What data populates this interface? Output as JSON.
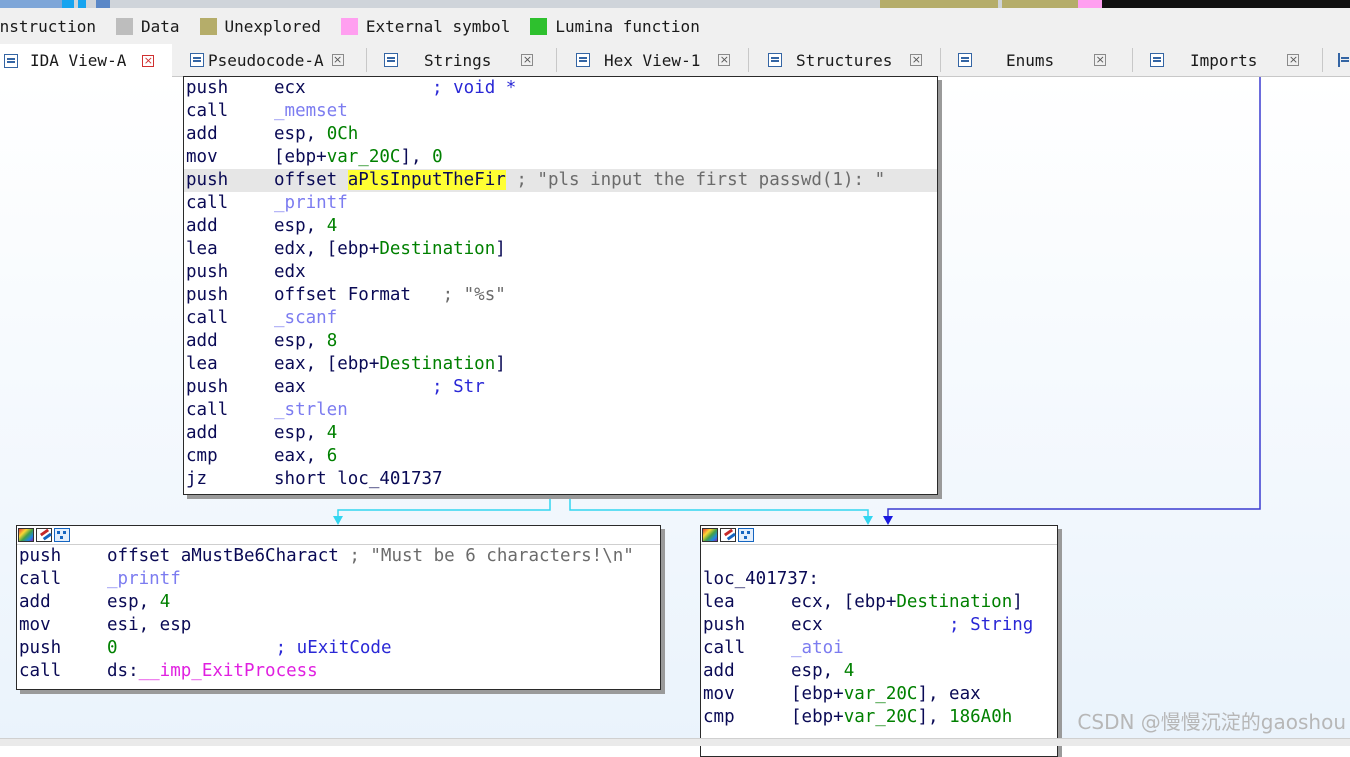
{
  "legend": [
    {
      "label": "Instruction",
      "color": "#bdbdbd"
    },
    {
      "label": "Data",
      "color": "#bdbdbd"
    },
    {
      "label": "Unexplored",
      "color": "#b5ad6a"
    },
    {
      "label": "External symbol",
      "color": "#ff9ff0"
    },
    {
      "label": "Lumina function",
      "color": "#2ec02e"
    }
  ],
  "tabs": [
    {
      "label": "IDA View-A",
      "icon": "graph-view-icon",
      "active": true
    },
    {
      "label": "Pseudocode-A",
      "icon": "pseudocode-icon"
    },
    {
      "label": "Strings",
      "icon": "strings-icon"
    },
    {
      "label": "Hex View-1",
      "icon": "hex-view-icon"
    },
    {
      "label": "Structures",
      "icon": "structures-icon"
    },
    {
      "label": "Enums",
      "icon": "enums-icon"
    },
    {
      "label": "Imports",
      "icon": "imports-icon"
    }
  ],
  "close_glyph": "×",
  "graph": {
    "node_main": [
      {
        "m": "push",
        "o": [
          {
            "t": "ecx            "
          },
          {
            "t": "; void *",
            "c": "cmt-b"
          }
        ]
      },
      {
        "m": "call",
        "o": [
          {
            "t": "_memset",
            "c": "fn"
          }
        ]
      },
      {
        "m": "add",
        "o": [
          {
            "t": "esp, "
          },
          {
            "t": "0Ch",
            "c": "num"
          }
        ]
      },
      {
        "m": "mov",
        "o": [
          {
            "t": "[ebp+"
          },
          {
            "t": "var_20C",
            "c": "var"
          },
          {
            "t": "], "
          },
          {
            "t": "0",
            "c": "num"
          }
        ]
      },
      {
        "m": "push",
        "hl": true,
        "o": [
          {
            "t": "offset "
          },
          {
            "t": "aPlsInputTheFir",
            "c": "hl"
          },
          {
            "t": " "
          },
          {
            "t": "; \"pls input the first passwd(1): \"",
            "c": "cmt"
          }
        ]
      },
      {
        "m": "call",
        "o": [
          {
            "t": "_printf",
            "c": "fn"
          }
        ]
      },
      {
        "m": "add",
        "o": [
          {
            "t": "esp, "
          },
          {
            "t": "4",
            "c": "num"
          }
        ]
      },
      {
        "m": "lea",
        "o": [
          {
            "t": "edx, [ebp+"
          },
          {
            "t": "Destination",
            "c": "var"
          },
          {
            "t": "]"
          }
        ]
      },
      {
        "m": "push",
        "o": [
          {
            "t": "edx"
          }
        ]
      },
      {
        "m": "push",
        "o": [
          {
            "t": "offset Format   "
          },
          {
            "t": "; \"%s\"",
            "c": "cmt"
          }
        ]
      },
      {
        "m": "call",
        "o": [
          {
            "t": "_scanf",
            "c": "fn"
          }
        ]
      },
      {
        "m": "add",
        "o": [
          {
            "t": "esp, "
          },
          {
            "t": "8",
            "c": "num"
          }
        ]
      },
      {
        "m": "lea",
        "o": [
          {
            "t": "eax, [ebp+"
          },
          {
            "t": "Destination",
            "c": "var"
          },
          {
            "t": "]"
          }
        ]
      },
      {
        "m": "push",
        "o": [
          {
            "t": "eax            "
          },
          {
            "t": "; Str",
            "c": "cmt-b"
          }
        ]
      },
      {
        "m": "call",
        "o": [
          {
            "t": "_strlen",
            "c": "fn"
          }
        ]
      },
      {
        "m": "add",
        "o": [
          {
            "t": "esp, "
          },
          {
            "t": "4",
            "c": "num"
          }
        ]
      },
      {
        "m": "cmp",
        "o": [
          {
            "t": "eax, "
          },
          {
            "t": "6",
            "c": "num"
          }
        ]
      },
      {
        "m": "jz",
        "o": [
          {
            "t": "short loc_401737"
          }
        ]
      }
    ],
    "node_left": [
      {
        "m": "push",
        "o": [
          {
            "t": "offset aMustBe6Charact "
          },
          {
            "t": "; \"Must be 6 characters!\\n\"",
            "c": "cmt"
          }
        ]
      },
      {
        "m": "call",
        "o": [
          {
            "t": "_printf",
            "c": "fn"
          }
        ]
      },
      {
        "m": "add",
        "o": [
          {
            "t": "esp, "
          },
          {
            "t": "4",
            "c": "num"
          }
        ]
      },
      {
        "m": "mov",
        "o": [
          {
            "t": "esi, esp"
          }
        ]
      },
      {
        "m": "push",
        "o": [
          {
            "t": "0",
            "c": "num"
          },
          {
            "t": "               "
          },
          {
            "t": "; uExitCode",
            "c": "cmt-b"
          }
        ]
      },
      {
        "m": "call",
        "o": [
          {
            "t": "ds:"
          },
          {
            "t": "__imp_ExitProcess",
            "c": "imp"
          }
        ]
      }
    ],
    "node_right": [
      {
        "m": "",
        "o": []
      },
      {
        "label": "loc_401737:"
      },
      {
        "m": "lea",
        "o": [
          {
            "t": "ecx, [ebp+"
          },
          {
            "t": "Destination",
            "c": "var"
          },
          {
            "t": "]"
          }
        ]
      },
      {
        "m": "push",
        "o": [
          {
            "t": "ecx            "
          },
          {
            "t": "; String",
            "c": "cmt-b"
          }
        ]
      },
      {
        "m": "call",
        "o": [
          {
            "t": "_atoi",
            "c": "fn"
          }
        ]
      },
      {
        "m": "add",
        "o": [
          {
            "t": "esp, "
          },
          {
            "t": "4",
            "c": "num"
          }
        ]
      },
      {
        "m": "mov",
        "o": [
          {
            "t": "[ebp+"
          },
          {
            "t": "var_20C",
            "c": "var"
          },
          {
            "t": "], eax"
          }
        ]
      },
      {
        "m": "cmp",
        "o": [
          {
            "t": "[ebp+"
          },
          {
            "t": "var_20C",
            "c": "var"
          },
          {
            "t": "], "
          },
          {
            "t": "186A0h",
            "c": "num"
          }
        ]
      }
    ]
  },
  "colors": {
    "edge_true": "#33d6f0",
    "edge_back": "#3b3bd0"
  },
  "watermark": "CSDN @慢慢沉淀的gaoshou"
}
